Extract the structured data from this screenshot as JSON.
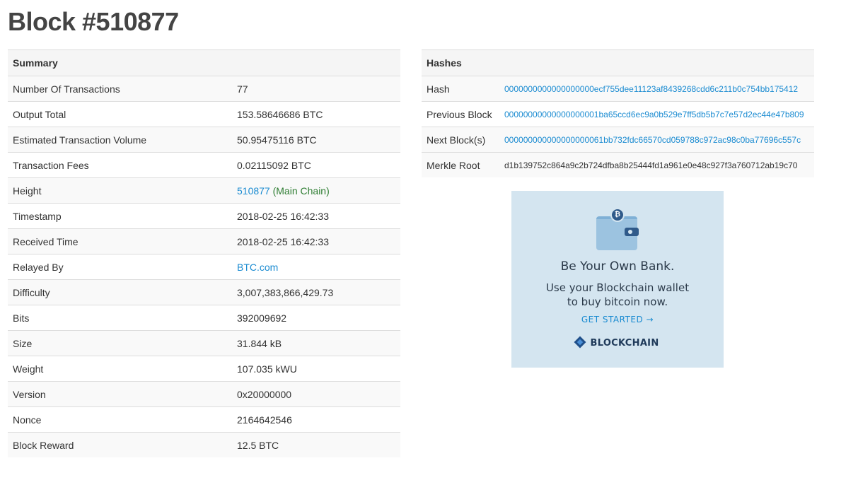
{
  "page_title": "Block #510877",
  "summary": {
    "header": "Summary",
    "rows": [
      {
        "label": "Number Of Transactions",
        "value": "77"
      },
      {
        "label": "Output Total",
        "value": "153.58646686 BTC"
      },
      {
        "label": "Estimated Transaction Volume",
        "value": "50.95475116 BTC"
      },
      {
        "label": "Transaction Fees",
        "value": "0.02115092 BTC"
      },
      {
        "label": "Height",
        "value": "510877",
        "suffix": "(Main Chain)"
      },
      {
        "label": "Timestamp",
        "value": "2018-02-25 16:42:33"
      },
      {
        "label": "Received Time",
        "value": "2018-02-25 16:42:33"
      },
      {
        "label": "Relayed By",
        "value": "BTC.com"
      },
      {
        "label": "Difficulty",
        "value": "3,007,383,866,429.73"
      },
      {
        "label": "Bits",
        "value": "392009692"
      },
      {
        "label": "Size",
        "value": "31.844 kB"
      },
      {
        "label": "Weight",
        "value": "107.035 kWU"
      },
      {
        "label": "Version",
        "value": "0x20000000"
      },
      {
        "label": "Nonce",
        "value": "2164642546"
      },
      {
        "label": "Block Reward",
        "value": "12.5 BTC"
      }
    ]
  },
  "hashes": {
    "header": "Hashes",
    "rows": [
      {
        "label": "Hash",
        "value": "0000000000000000000ecf755dee11123af8439268cdd6c211b0c754bb175412"
      },
      {
        "label": "Previous Block",
        "value": "00000000000000000001ba65ccd6ec9a0b529e7ff5db5b7c7e57d2ec44e47b809"
      },
      {
        "label": "Next Block(s)",
        "value": "000000000000000000061bb732fdc66570cd059788c972ac98c0ba77696c557c"
      },
      {
        "label": "Merkle Root",
        "value": "d1b139752c864a9c2b724dfba8b25444fd1a961e0e48c927f3a760712ab19c70"
      }
    ]
  },
  "ad": {
    "coin_symbol": "₿",
    "headline": "Be Your Own Bank.",
    "line1": "Use your Blockchain wallet",
    "line2": "to buy bitcoin now.",
    "cta": "GET STARTED →",
    "brand": "BLOCKCHAIN",
    "icons": [
      "wallet-icon",
      "bitcoin-coin-icon",
      "blockchain-logo-icon"
    ]
  },
  "colors": {
    "link": "#1a8bd1",
    "main_chain": "#2e7d32",
    "ad_background": "#d4e5f0",
    "header_background": "#f5f5f5",
    "stripe": "#f9f9f9"
  }
}
